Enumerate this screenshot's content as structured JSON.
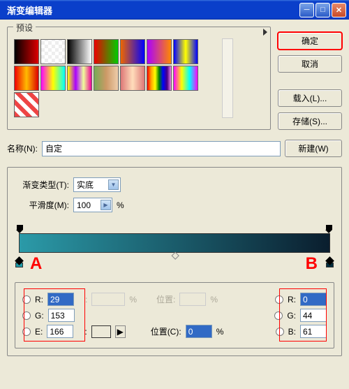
{
  "title": "渐变编辑器",
  "presets_label": "预设",
  "buttons": {
    "ok": "确定",
    "cancel": "取消",
    "load": "载入(L)...",
    "save": "存储(S)...",
    "new": "新建(W)"
  },
  "name": {
    "label": "名称(N):",
    "value": "自定"
  },
  "gradient": {
    "type_label": "渐变类型(T):",
    "type_value": "实底",
    "smooth_label": "平滑度(M):",
    "smooth_value": "100",
    "percent": "%"
  },
  "presets": [
    "linear-gradient(90deg,#000,#d00)",
    "repeating-conic-gradient(#fff 0 25%,#eee 0 50%) 0/10px 10px",
    "linear-gradient(90deg,#000,#fff)",
    "linear-gradient(90deg,#e00,#0c0)",
    "linear-gradient(90deg,#e60,#00f)",
    "linear-gradient(90deg,#a0f,#f80)",
    "linear-gradient(90deg,#00f,#ff0,#00f)",
    "linear-gradient(90deg,#e00,#fb0,#d00)",
    "linear-gradient(90deg,#f0f,#ff0,#0ff)",
    "linear-gradient(90deg,#ff0,#a0f,#ef9,#e09)",
    "linear-gradient(90deg,#7a5,#c96,#eca)",
    "linear-gradient(90deg,#d77,#fdb,#d77)",
    "linear-gradient(90deg,red,orange,yellow,green,blue,indigo,violet)",
    "linear-gradient(90deg,#f0f,#ff0,#0ff,#f0f)",
    "repeating-linear-gradient(45deg,#e44 0 6px,#fff 6px 12px)"
  ],
  "markers": {
    "a": "A",
    "b": "B"
  },
  "stops": {
    "left": {
      "r_lbl": "R:",
      "r": "29",
      "g_lbl": "G:",
      "g": "153",
      "b_lbl": "E:",
      "b": "166",
      "color": "#1d99a6"
    },
    "right": {
      "r_lbl": "R:",
      "r": "0",
      "g_lbl": "G:",
      "g": "44",
      "b_lbl": "B:",
      "b": "61",
      "color": "#002c3d"
    },
    "opacity_colon": ":",
    "pos_lbl_dim": "位置:",
    "pos_lbl": "位置(C):",
    "pos_val": "0",
    "pct": "%"
  }
}
